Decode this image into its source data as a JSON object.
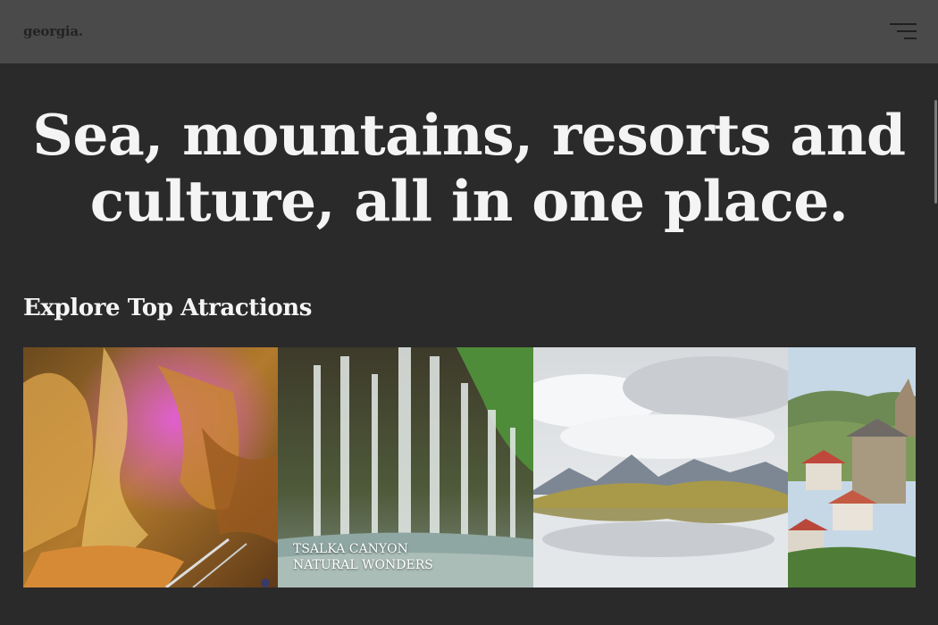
{
  "header": {
    "logo": "georgia.",
    "menu_icon": "hamburger-menu-icon"
  },
  "hero": {
    "line1": "Sea, mountains, resorts and",
    "line2": "culture, all in one place."
  },
  "attractions": {
    "title": "Explore Top Atractions",
    "cards": [
      {
        "image": "cave"
      },
      {
        "image": "waterfall",
        "caption_line1": "TSALKA CANYON",
        "caption_line2": "NATURAL WONDERS"
      },
      {
        "image": "mountain-lake"
      },
      {
        "image": "village-church"
      }
    ]
  }
}
